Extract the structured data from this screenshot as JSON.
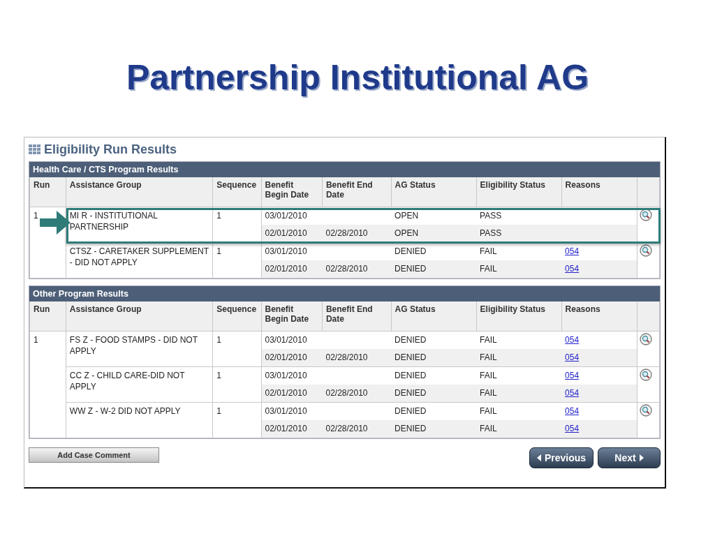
{
  "slide_title": "Partnership Institutional AG",
  "window": {
    "title": "Eligibility Run Results"
  },
  "sections": [
    {
      "title": "Health Care / CTS Program Results",
      "run": "1",
      "columns": [
        "Run",
        "Assistance Group",
        "Sequence",
        "Benefit Begin Date",
        "Benefit End Date",
        "AG Status",
        "Eligibility Status",
        "Reasons"
      ],
      "groups": [
        {
          "assistance_group": "MI R - INSTITUTIONAL PARTNERSHIP",
          "sequence": "1",
          "highlighted": true,
          "periods": [
            {
              "begin": "03/01/2010",
              "ag_status": "OPEN",
              "eligibility_status": "PASS"
            },
            {
              "begin": "02/01/2010",
              "end": "02/28/2010",
              "ag_status": "OPEN",
              "eligibility_status": "PASS"
            }
          ]
        },
        {
          "assistance_group": "CTSZ - CARETAKER SUPPLEMENT - DID NOT APPLY",
          "sequence": "1",
          "highlighted": false,
          "periods": [
            {
              "begin": "03/01/2010",
              "ag_status": "DENIED",
              "eligibility_status": "FAIL",
              "reason": "054"
            },
            {
              "begin": "02/01/2010",
              "end": "02/28/2010",
              "ag_status": "DENIED",
              "eligibility_status": "FAIL",
              "reason": "054"
            }
          ]
        }
      ]
    },
    {
      "title": "Other Program Results",
      "run": "1",
      "columns": [
        "Run",
        "Assistance Group",
        "Sequence",
        "Benefit Begin Date",
        "Benefit End Date",
        "AG Status",
        "Eligibility Status",
        "Reasons"
      ],
      "groups": [
        {
          "assistance_group": "FS Z - FOOD STAMPS - DID NOT APPLY",
          "sequence": "1",
          "highlighted": false,
          "periods": [
            {
              "begin": "03/01/2010",
              "ag_status": "DENIED",
              "eligibility_status": "FAIL",
              "reason": "054"
            },
            {
              "begin": "02/01/2010",
              "end": "02/28/2010",
              "ag_status": "DENIED",
              "eligibility_status": "FAIL",
              "reason": "054"
            }
          ]
        },
        {
          "assistance_group": "CC Z - CHILD CARE-DID NOT APPLY",
          "sequence": "1",
          "highlighted": false,
          "periods": [
            {
              "begin": "03/01/2010",
              "ag_status": "DENIED",
              "eligibility_status": "FAIL",
              "reason": "054"
            },
            {
              "begin": "02/01/2010",
              "end": "02/28/2010",
              "ag_status": "DENIED",
              "eligibility_status": "FAIL",
              "reason": "054"
            }
          ]
        },
        {
          "assistance_group": "WW Z - W-2 DID NOT APPLY",
          "sequence": "1",
          "highlighted": false,
          "periods": [
            {
              "begin": "03/01/2010",
              "ag_status": "DENIED",
              "eligibility_status": "FAIL",
              "reason": "054"
            },
            {
              "begin": "02/01/2010",
              "end": "02/28/2010",
              "ag_status": "DENIED",
              "eligibility_status": "FAIL",
              "reason": "054"
            }
          ]
        }
      ]
    }
  ],
  "buttons": {
    "add_comment": "Add Case Comment",
    "previous": "Previous",
    "next": "Next"
  }
}
